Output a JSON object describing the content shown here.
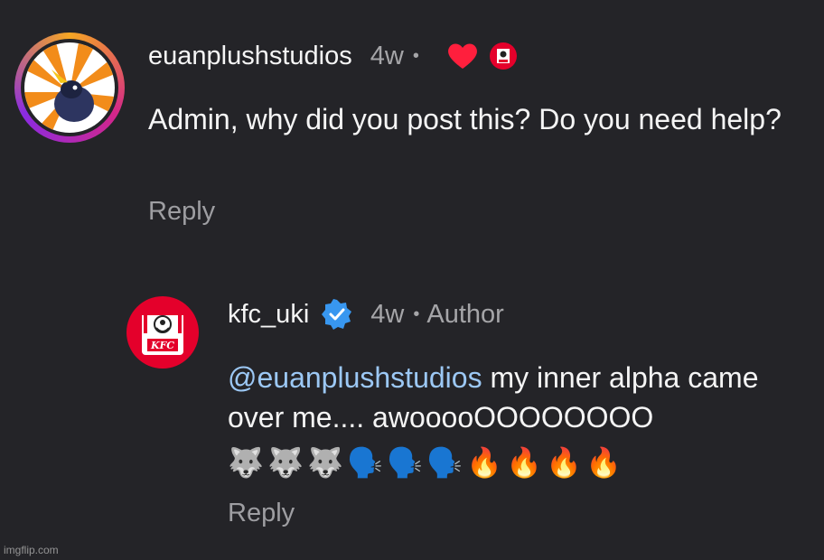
{
  "comments": [
    {
      "username": "euanplushstudios",
      "time": "4w",
      "separator": "•",
      "text": "Admin, why did you post this? Do you need help?",
      "reply_label": "Reply",
      "liked_by_author": true,
      "avatar_icon": "sunburst-character-avatar"
    },
    {
      "username": "kfc_uki",
      "verified": true,
      "time": "4w",
      "separator": "•",
      "badge": "Author",
      "mention": "@euanplushstudios",
      "text_rest": " my inner alpha came over me.... awooooOOOOOOOO",
      "emojis": [
        "🐺",
        "🐺",
        "🐺",
        "🗣️",
        "🗣️",
        "🗣️",
        "🔥",
        "🔥",
        "🔥",
        "🔥"
      ],
      "reply_label": "Reply",
      "avatar_icon": "kfc-logo-avatar"
    }
  ],
  "watermark": "imgflip.com",
  "colors": {
    "background": "#242428",
    "mention": "#9cc8f5",
    "muted": "#a5a5a8",
    "heart": "#ff1f3d",
    "kfc_red": "#e4002b",
    "verified_blue": "#3897f0"
  }
}
